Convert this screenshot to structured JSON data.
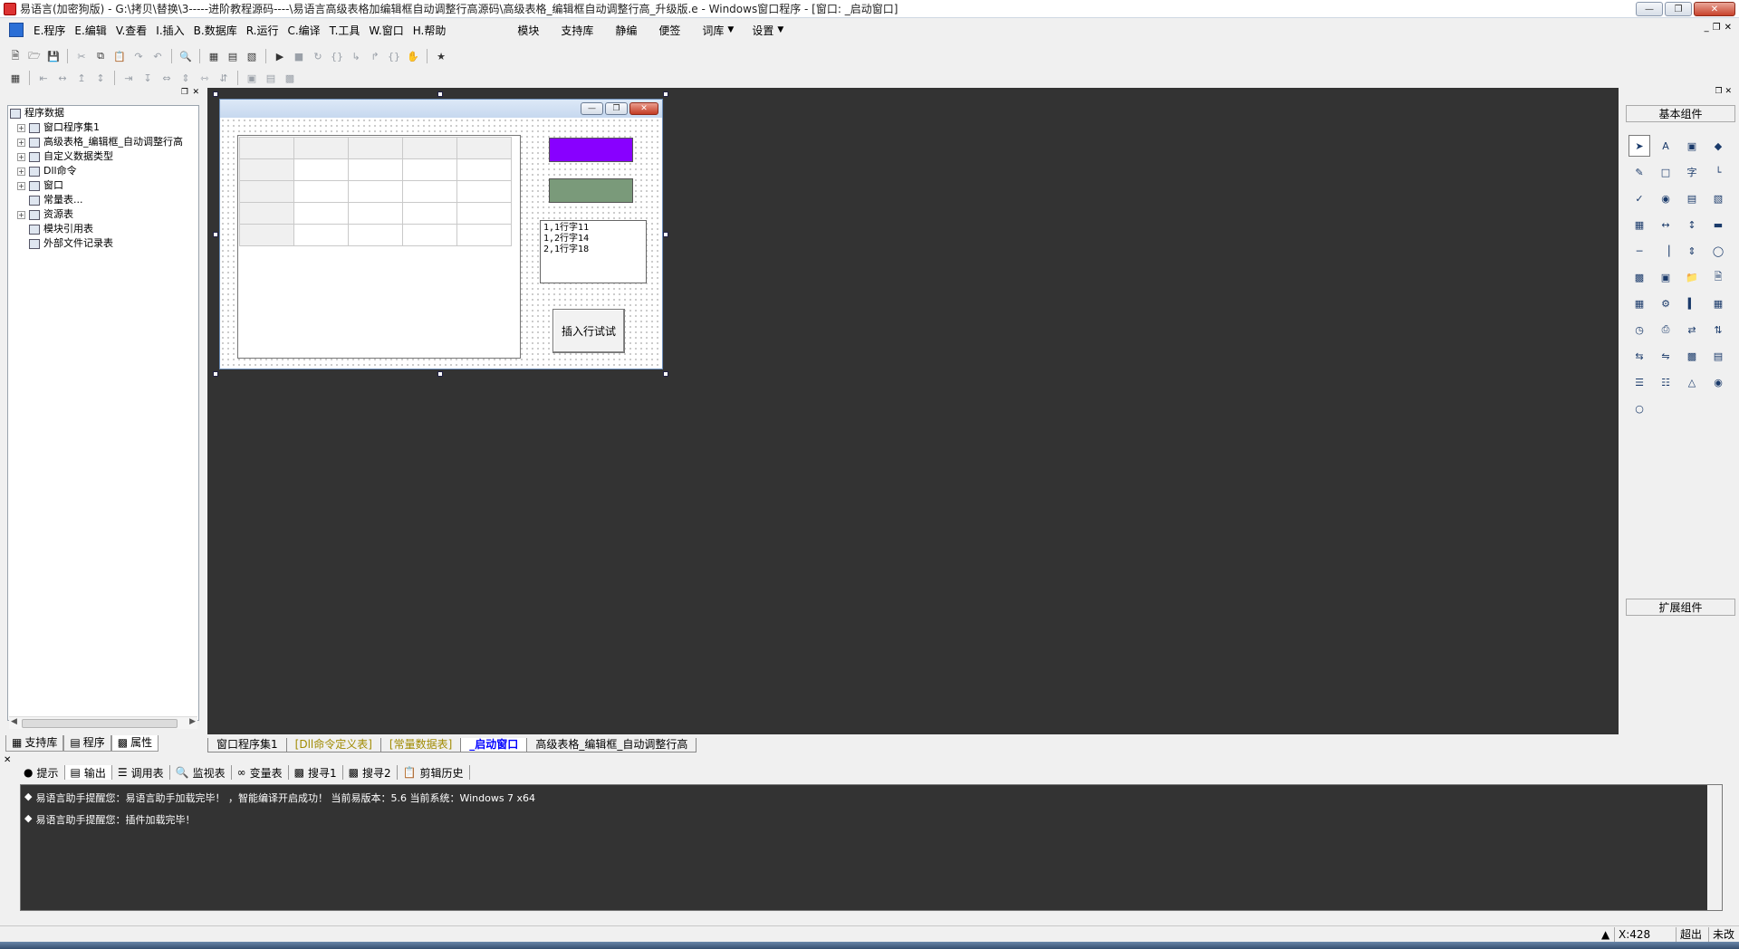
{
  "window": {
    "title": "易语言(加密狗版) - G:\\拷贝\\替换\\3-----进阶教程源码----\\易语言高级表格加编辑框自动调整行高源码\\高级表格_编辑框自动调整行高_升级版.e - Windows窗口程序 - [窗口: _启动窗口]"
  },
  "menu": {
    "items": [
      "E.程序",
      "E.编辑",
      "V.查看",
      "I.插入",
      "B.数据库",
      "R.运行",
      "C.编译",
      "T.工具",
      "W.窗口",
      "H.帮助"
    ],
    "extra": [
      "模块",
      "支持库",
      "静编",
      "便签",
      "词库",
      "设置"
    ]
  },
  "left_panel": {
    "tree": [
      {
        "label": "程序数据",
        "level": 0,
        "toggle": ""
      },
      {
        "label": "窗口程序集1",
        "level": 1,
        "toggle": "+"
      },
      {
        "label": "高级表格_编辑框_自动调整行高",
        "level": 1,
        "toggle": "+"
      },
      {
        "label": "自定义数据类型",
        "level": 1,
        "toggle": "+"
      },
      {
        "label": "Dll命令",
        "level": 1,
        "toggle": "+"
      },
      {
        "label": "窗口",
        "level": 1,
        "toggle": "+"
      },
      {
        "label": "常量表...",
        "level": 1,
        "toggle": ""
      },
      {
        "label": "资源表",
        "level": 1,
        "toggle": "+"
      },
      {
        "label": "模块引用表",
        "level": 1,
        "toggle": ""
      },
      {
        "label": "外部文件记录表",
        "level": 1,
        "toggle": ""
      }
    ],
    "tabs": [
      "支持库",
      "程序",
      "属性"
    ]
  },
  "designer": {
    "listbox_lines": [
      "1,1行字11",
      "1,2行字14",
      "2,1行字18"
    ],
    "button_label": "插入行试试",
    "colors": {
      "purple_box": "#8800ff",
      "green_box": "#7a9a7a"
    }
  },
  "doc_tabs": [
    "窗口程序集1",
    "[Dll命令定义表]",
    "[常量数据表]",
    "_启动窗口",
    "高级表格_编辑框_自动调整行高"
  ],
  "right_panel": {
    "basic_title": "基本组件",
    "ext_title": "扩展组件"
  },
  "bottom": {
    "tabs": [
      "提示",
      "输出",
      "调用表",
      "监视表",
      "变量表",
      "搜寻1",
      "搜寻2",
      "剪辑历史"
    ],
    "messages": [
      "易语言助手提醒您：易语言助手加载完毕！   ，智能编译开启成功！  当前易版本：5.6  当前系统：Windows 7 x64",
      "易语言助手提醒您：插件加载完毕！"
    ]
  },
  "status": {
    "coord": "X:428",
    "mode1": "超出",
    "mode2": "未改"
  }
}
